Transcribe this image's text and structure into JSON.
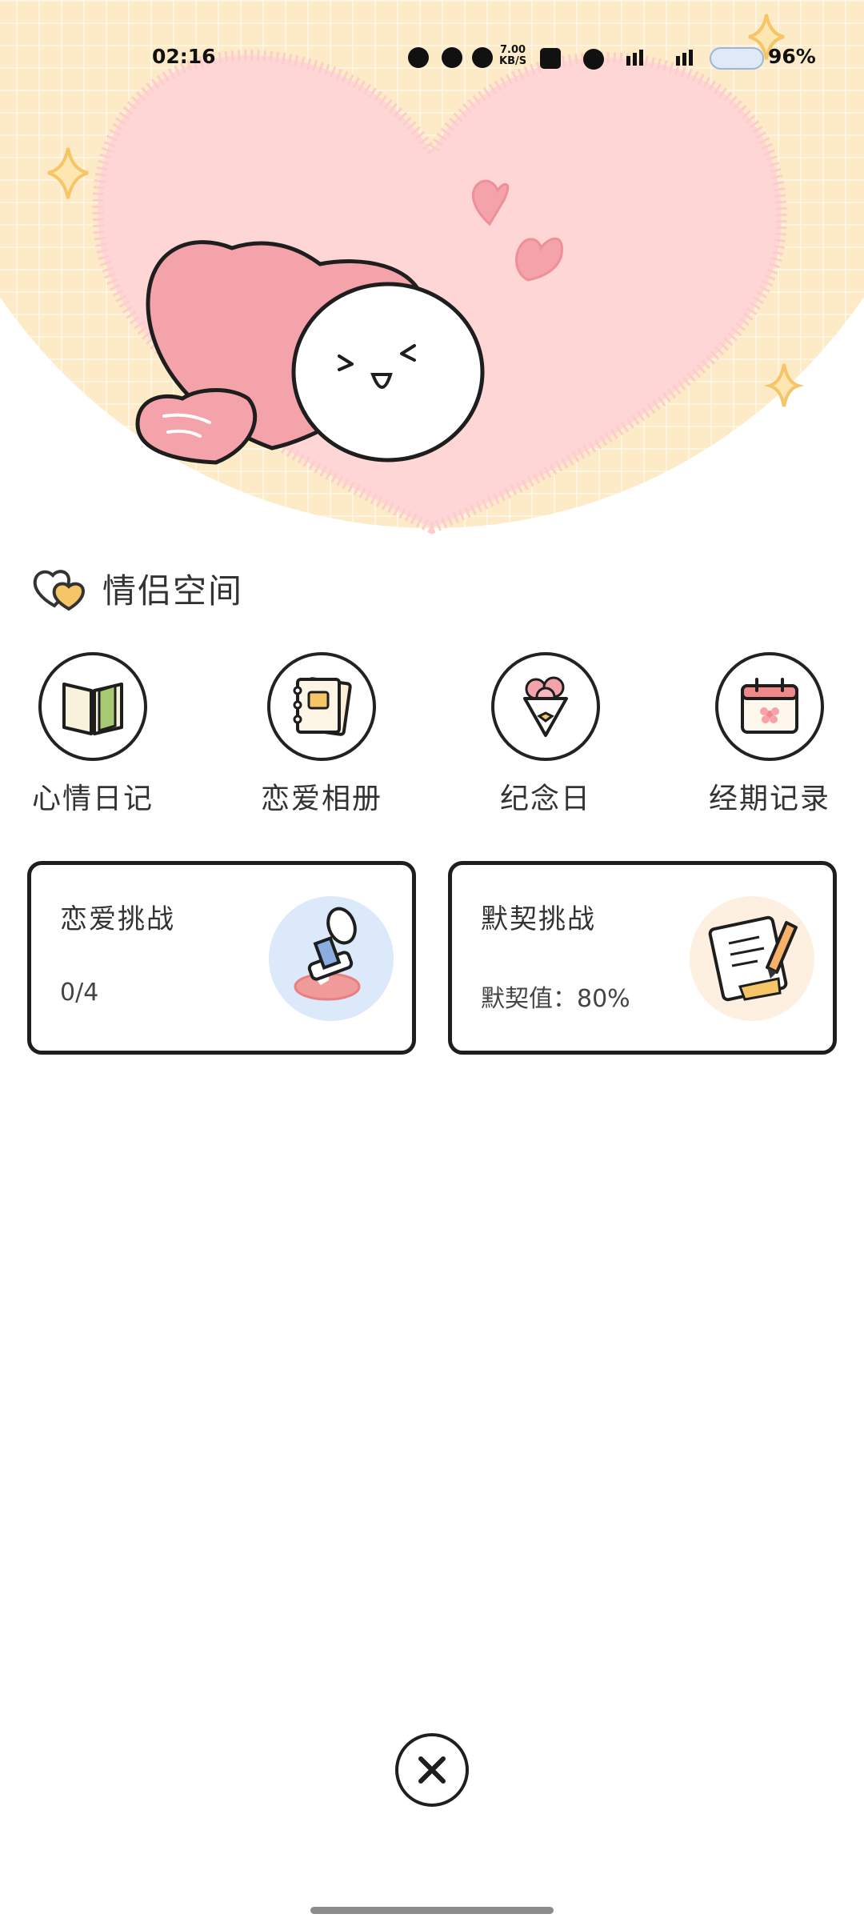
{
  "status_bar": {
    "time": "02:16",
    "network_speed_value": "7.00",
    "network_speed_unit": "KB/S",
    "battery": "96%",
    "carrier_badge": "cat"
  },
  "section": {
    "title": "情侣空间"
  },
  "features": [
    {
      "label": "心情日记",
      "icon": "book-icon"
    },
    {
      "label": "恋爱相册",
      "icon": "album-icon"
    },
    {
      "label": "纪念日",
      "icon": "bouquet-icon"
    },
    {
      "label": "经期记录",
      "icon": "calendar-icon"
    }
  ],
  "cards": [
    {
      "title": "恋爱挑战",
      "value": "0/4",
      "icon": "stamp-icon"
    },
    {
      "title": "默契挑战",
      "value": "默契值：80%",
      "icon": "notepad-pencil-icon"
    }
  ],
  "close_icon": "close-icon",
  "colors": {
    "banner": "#fdebc7",
    "heart": "#ffd8d8",
    "pink": "#f4a3aa",
    "outline": "#1e1e1e"
  }
}
